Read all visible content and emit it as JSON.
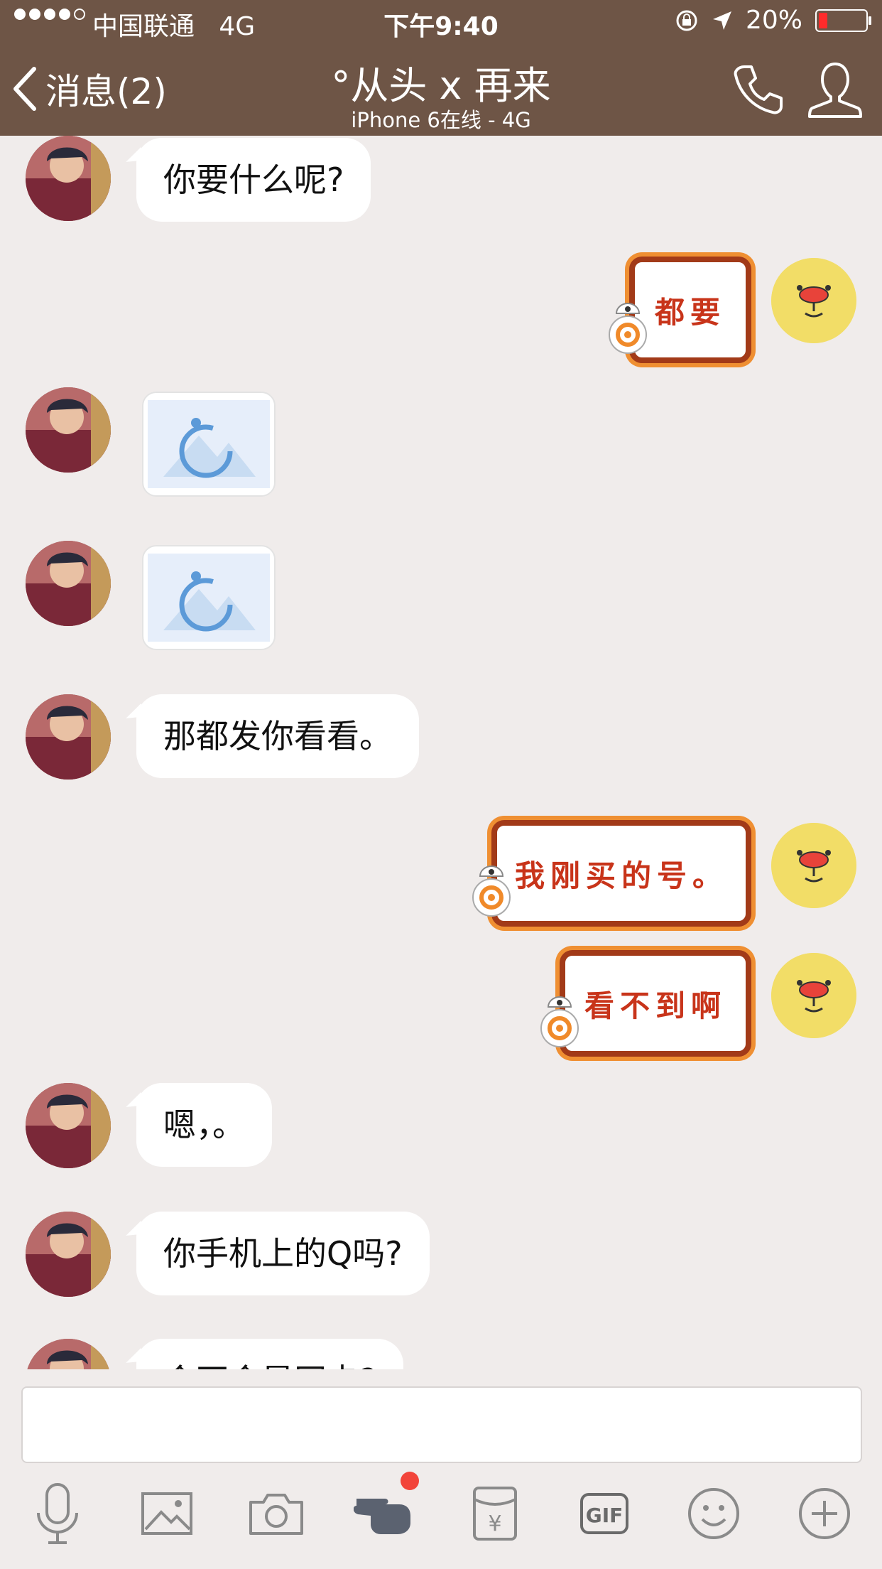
{
  "status_bar": {
    "carrier": "中国联通",
    "network": "4G",
    "time": "下午9:40",
    "battery": "20%",
    "battery_level": 0.2
  },
  "nav": {
    "back_label": "消息(2)",
    "title": "°从头 x 再来",
    "subtitle": "iPhone 6在线 - 4G"
  },
  "messages": [
    {
      "side": "left",
      "type": "text",
      "text": "你要什么呢?"
    },
    {
      "side": "right",
      "type": "sticker",
      "text": "都要"
    },
    {
      "side": "left",
      "type": "image"
    },
    {
      "side": "left",
      "type": "image"
    },
    {
      "side": "left",
      "type": "text",
      "text": "那都发你看看。"
    },
    {
      "side": "right",
      "type": "sticker",
      "text": "我刚买的号。"
    },
    {
      "side": "right",
      "type": "sticker",
      "text": "看不到啊"
    },
    {
      "side": "left",
      "type": "text",
      "text": "嗯，。"
    },
    {
      "side": "left",
      "type": "text",
      "text": "你手机上的Q吗?"
    },
    {
      "side": "left",
      "type": "text",
      "text": "会不会是网卡?"
    }
  ],
  "toolbar": {
    "icons": [
      "microphone-icon",
      "image-icon",
      "camera-icon",
      "poke-icon",
      "red-packet-icon",
      "gif-icon",
      "emoji-icon",
      "plus-icon"
    ],
    "gif_label": "GIF",
    "yuan_label": "¥"
  },
  "colors": {
    "header": "#6e5546",
    "background": "#f0eceb",
    "sticker_text": "#c8341a",
    "sticker_frame": "#a23a18",
    "badge": "#f2443a"
  }
}
